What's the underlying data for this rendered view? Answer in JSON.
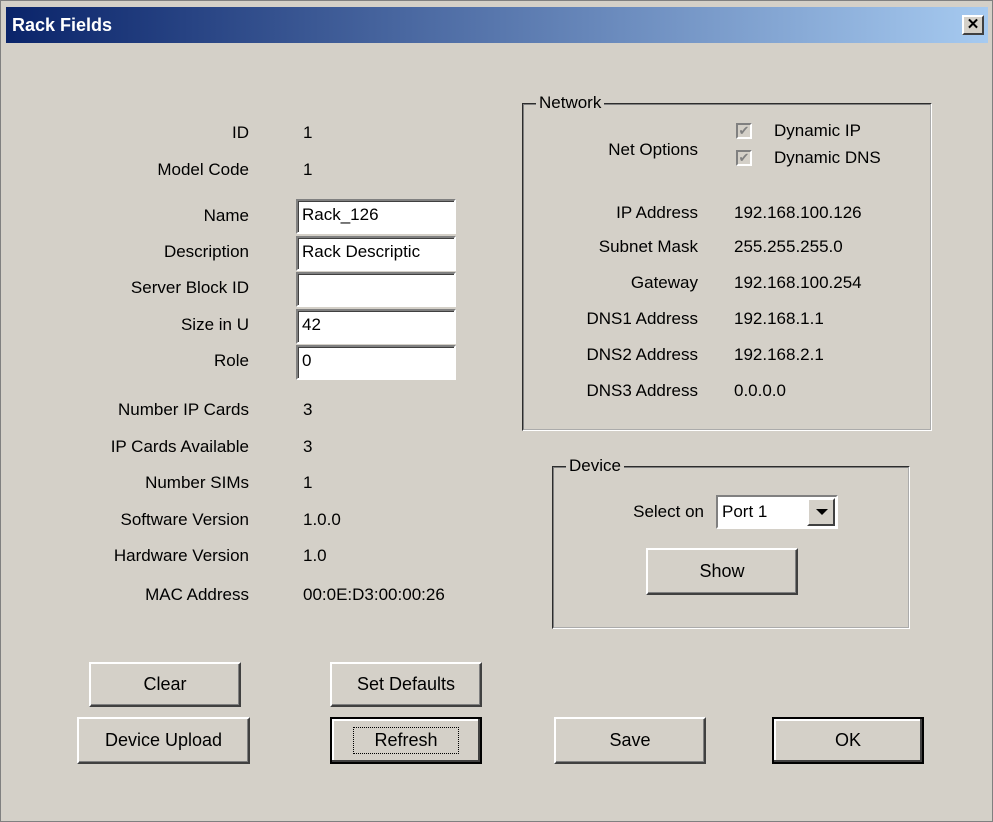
{
  "window": {
    "title": "Rack Fields",
    "close_glyph": "✕"
  },
  "fields": {
    "id_label": "ID",
    "id_value": "1",
    "model_label": "Model Code",
    "model_value": "1",
    "name_label": "Name",
    "name_value": "Rack_126",
    "description_label": "Description",
    "description_value": "Rack Descriptic",
    "server_block_label": "Server Block ID",
    "server_block_value": "",
    "size_label": "Size in U",
    "size_value": "42",
    "role_label": "Role",
    "role_value": "0",
    "ip_cards_label": "Number IP Cards",
    "ip_cards_value": "3",
    "ip_avail_label": "IP Cards Available",
    "ip_avail_value": "3",
    "sims_label": "Number SIMs",
    "sims_value": "1",
    "sw_label": "Software Version",
    "sw_value": "1.0.0",
    "hw_label": "Hardware Version",
    "hw_value": "1.0",
    "mac_label": "MAC Address",
    "mac_value": "00:0E:D3:00:00:26"
  },
  "network": {
    "title": "Network",
    "net_options_label": "Net Options",
    "dynamic_ip_label": "Dynamic IP",
    "dynamic_ip_checked": true,
    "dynamic_dns_label": "Dynamic DNS",
    "dynamic_dns_checked": true,
    "ip_label": "IP Address",
    "ip_value": "192.168.100.126",
    "subnet_label": "Subnet Mask",
    "subnet_value": "255.255.255.0",
    "gateway_label": "Gateway",
    "gateway_value": "192.168.100.254",
    "dns1_label": "DNS1 Address",
    "dns1_value": "192.168.1.1",
    "dns2_label": "DNS2 Address",
    "dns2_value": "192.168.2.1",
    "dns3_label": "DNS3 Address",
    "dns3_value": "0.0.0.0"
  },
  "device": {
    "title": "Device",
    "select_label": "Select on",
    "select_value": "Port 1",
    "show_label": "Show"
  },
  "buttons": {
    "clear": "Clear",
    "set_defaults": "Set Defaults",
    "device_upload": "Device Upload",
    "refresh": "Refresh",
    "save": "Save",
    "ok": "OK"
  },
  "icons": {
    "close": "close-icon",
    "dropdown": "chevron-down-icon",
    "check": "checkmark-icon"
  },
  "colors": {
    "title_start": "#0a246a",
    "title_end": "#a6caf0",
    "face": "#d4d0c8"
  }
}
